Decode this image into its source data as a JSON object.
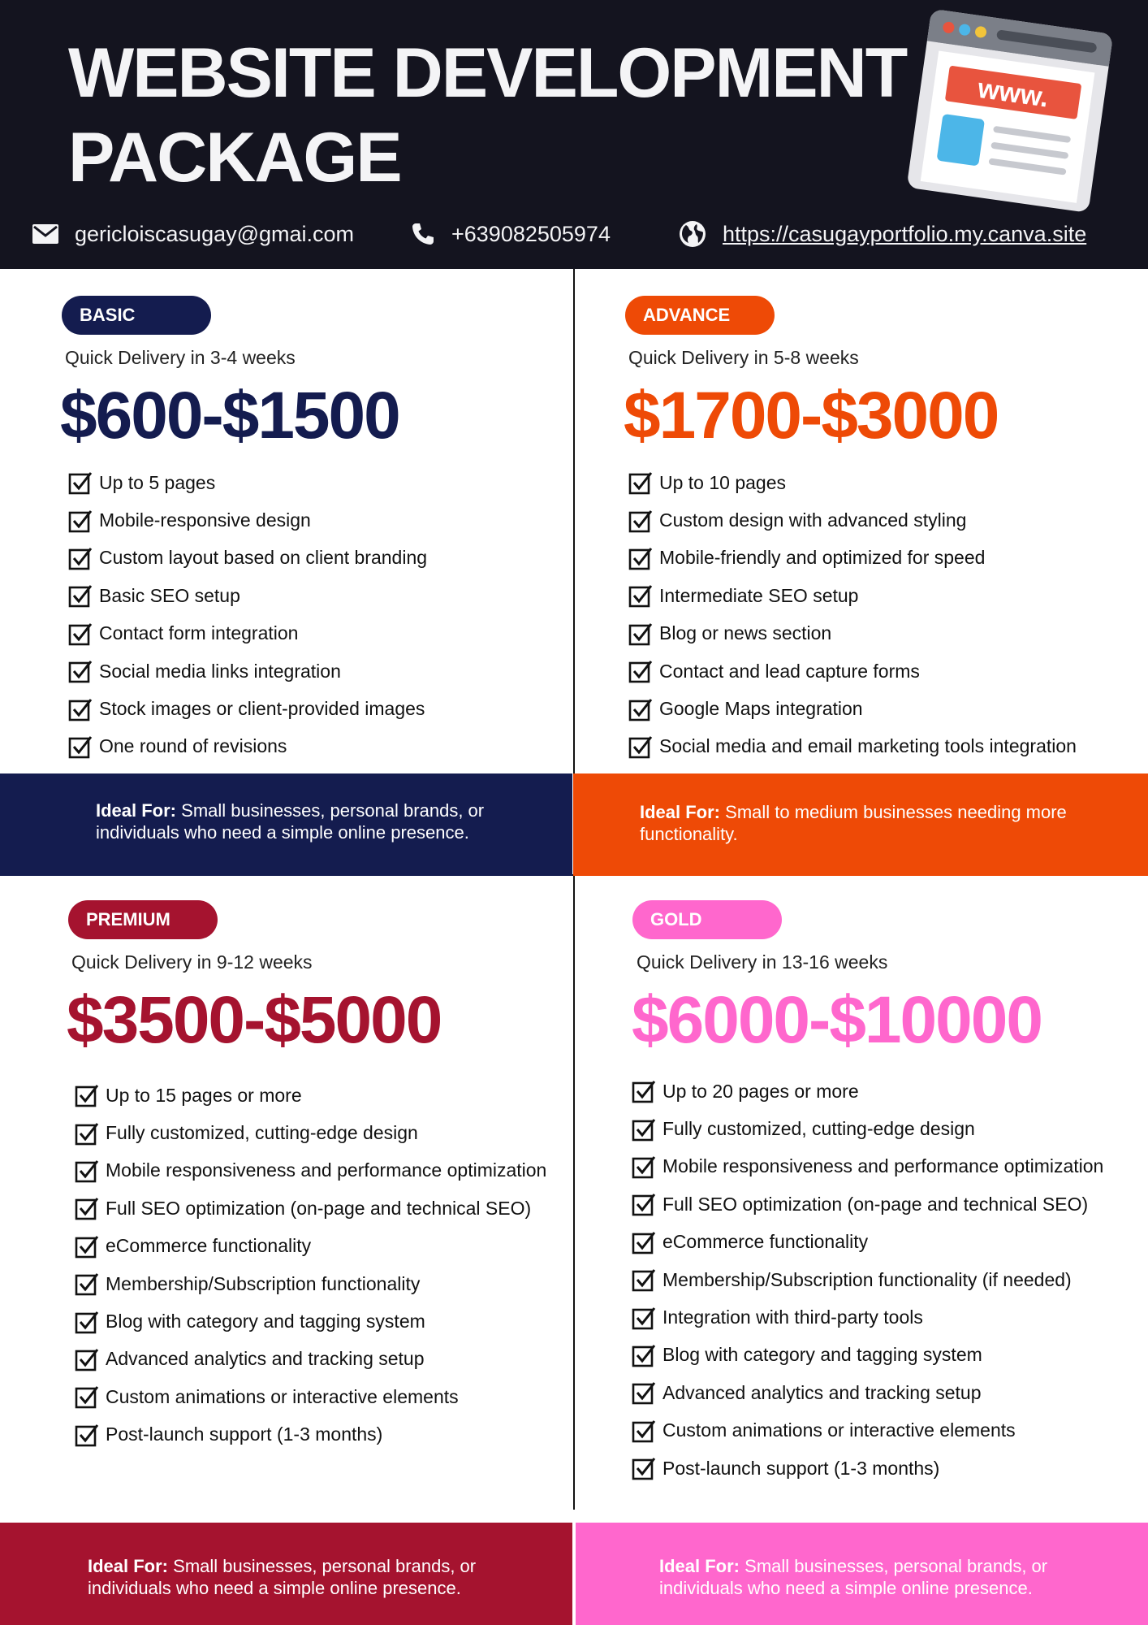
{
  "header": {
    "title_line1": "WEBSITE DEVELOPMENT",
    "title_line2": "PACKAGE",
    "browser_graphic_text": "www.",
    "email": "gericloiscasugay@gmai.com",
    "phone": "+639082505974",
    "website": "https://casugayportfolio.my.canva.site"
  },
  "packages": {
    "basic": {
      "badge": "BASIC",
      "delivery": "Quick Delivery in 3-4 weeks",
      "price": "$600-$1500",
      "features": [
        "Up to 5 pages",
        "Mobile-responsive design",
        "Custom layout based on client branding",
        "Basic SEO setup",
        "Contact form integration",
        "Social media links integration",
        "Stock images or client-provided images",
        "One round of revisions"
      ],
      "ideal_label": "Ideal For:",
      "ideal_line1": "Small businesses, personal brands, or",
      "ideal_line2": "individuals who need a simple online presence."
    },
    "advance": {
      "badge": "ADVANCE",
      "delivery": "Quick Delivery in 5-8 weeks",
      "price": "$1700-$3000",
      "features": [
        "Up to 10 pages",
        "Custom design with advanced styling",
        "Mobile-friendly and optimized for speed",
        "Intermediate SEO setup",
        "Blog or news section",
        "Contact and lead capture forms",
        "Google Maps integration",
        "Social media and email marketing tools integration"
      ],
      "ideal_label": "Ideal For:",
      "ideal_line1": "Small to medium businesses needing more",
      "ideal_line2": "functionality."
    },
    "premium": {
      "badge": "PREMIUM",
      "delivery": "Quick Delivery in 9-12 weeks",
      "price": "$3500-$5000",
      "features": [
        "Up to 15 pages or more",
        "Fully customized, cutting-edge design",
        "Mobile responsiveness and performance optimization",
        "Full SEO optimization (on-page and technical SEO)",
        "eCommerce functionality",
        "Membership/Subscription functionality",
        "Blog with category and tagging system",
        "Advanced analytics and tracking setup",
        "Custom animations or interactive elements",
        "Post-launch support (1-3 months)"
      ],
      "ideal_label": "Ideal For:",
      "ideal_line1": "Small businesses, personal brands, or",
      "ideal_line2": "individuals who need a simple online presence."
    },
    "gold": {
      "badge": "GOLD",
      "delivery": "Quick Delivery in 13-16 weeks",
      "price": "$6000-$10000",
      "features": [
        "Up to 20 pages or more",
        "Fully customized, cutting-edge design",
        "Mobile responsiveness and performance optimization",
        "Full SEO optimization (on-page and technical SEO)",
        "eCommerce functionality",
        "Membership/Subscription functionality (if needed)",
        "Integration with third-party tools",
        "Blog with category and tagging system",
        "Advanced analytics and tracking setup",
        "Custom animations or interactive elements",
        "Post-launch support (1-3 months)"
      ],
      "ideal_label": "Ideal For:",
      "ideal_line1": "Small businesses, personal brands, or",
      "ideal_line2": "individuals who need a simple online presence."
    }
  },
  "colors": {
    "header_bg": "#14141f",
    "basic": "#141c4f",
    "advance": "#ee4a06",
    "premium": "#a5132f",
    "gold": "#ff67cd"
  },
  "icons": [
    "mail-icon",
    "phone-icon",
    "globe-icon",
    "browser-www-icon",
    "checkbox-icon"
  ]
}
